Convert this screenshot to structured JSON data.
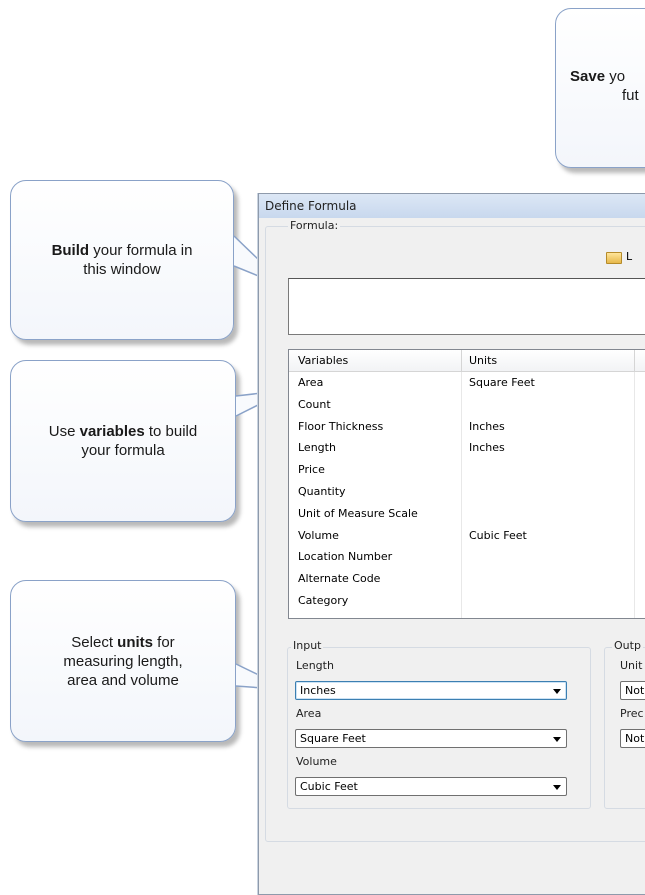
{
  "callouts": {
    "save": {
      "bold": "Save",
      "rest": " yo",
      "line2": "fut"
    },
    "build": {
      "bold": "Build",
      "rest": " your formula in",
      "line2": "this window"
    },
    "variables": {
      "pre": "Use ",
      "bold": "variables",
      "rest": " to build",
      "line2": "your formula"
    },
    "units": {
      "line1": "Select ",
      "bold": "units",
      "rest": " for",
      "line2": "measuring length,",
      "line3": "area and volume"
    }
  },
  "dialog": {
    "title": "Define Formula",
    "formula_label": "Formula:",
    "load_label": "L"
  },
  "variables_table": {
    "headers": [
      "Variables",
      "Units"
    ],
    "rows": [
      {
        "name": "Area",
        "unit": "Square Feet"
      },
      {
        "name": "Count",
        "unit": ""
      },
      {
        "name": "Floor Thickness",
        "unit": "Inches"
      },
      {
        "name": "Length",
        "unit": "Inches"
      },
      {
        "name": "Price",
        "unit": ""
      },
      {
        "name": "Quantity",
        "unit": ""
      },
      {
        "name": "Unit of Measure Scale",
        "unit": ""
      },
      {
        "name": "Volume",
        "unit": "Cubic Feet"
      },
      {
        "name": "Location Number",
        "unit": ""
      },
      {
        "name": "Alternate Code",
        "unit": ""
      },
      {
        "name": "Category",
        "unit": ""
      }
    ]
  },
  "input_group": {
    "title": "Input",
    "length_label": "Length",
    "length_value": "Inches",
    "area_label": "Area",
    "area_value": "Square Feet",
    "volume_label": "Volume",
    "volume_value": "Cubic Feet"
  },
  "output_group": {
    "title": "Outp",
    "units_label": "Unit",
    "units_value": "Not",
    "precision_label": "Prec",
    "precision_value": "Not"
  },
  "colors": {
    "callout_border": "#8aa2c8",
    "titlebar": "#dce7f5",
    "dialog_bg": "#f0f0f0"
  }
}
